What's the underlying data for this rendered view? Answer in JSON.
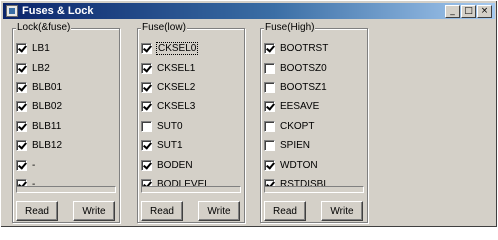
{
  "window": {
    "title": "Fuses & Lock",
    "minimize_label": "_",
    "maximize_label": "□",
    "close_label": "×"
  },
  "groups": [
    {
      "title": "Lock(&fuse)",
      "items": [
        {
          "label": "LB1",
          "checked": true
        },
        {
          "label": "LB2",
          "checked": true
        },
        {
          "label": "BLB01",
          "checked": true
        },
        {
          "label": "BLB02",
          "checked": true
        },
        {
          "label": "BLB11",
          "checked": true
        },
        {
          "label": "BLB12",
          "checked": true
        },
        {
          "label": "-",
          "checked": true
        },
        {
          "label": "-",
          "checked": true
        }
      ],
      "read_label": "Read",
      "write_label": "Write"
    },
    {
      "title": "Fuse(low)",
      "items": [
        {
          "label": "CKSEL0",
          "checked": true,
          "focused": true
        },
        {
          "label": "CKSEL1",
          "checked": true
        },
        {
          "label": "CKSEL2",
          "checked": true
        },
        {
          "label": "CKSEL3",
          "checked": true
        },
        {
          "label": "SUT0",
          "checked": false
        },
        {
          "label": "SUT1",
          "checked": true
        },
        {
          "label": "BODEN",
          "checked": true
        },
        {
          "label": "BODLEVEL",
          "checked": true
        }
      ],
      "read_label": "Read",
      "write_label": "Write"
    },
    {
      "title": "Fuse(High)",
      "items": [
        {
          "label": "BOOTRST",
          "checked": true
        },
        {
          "label": "BOOTSZ0",
          "checked": false
        },
        {
          "label": "BOOTSZ1",
          "checked": false
        },
        {
          "label": "EESAVE",
          "checked": true
        },
        {
          "label": "CKOPT",
          "checked": false
        },
        {
          "label": "SPIEN",
          "checked": false
        },
        {
          "label": "WDTON",
          "checked": true
        },
        {
          "label": "RSTDISBL",
          "checked": true
        }
      ],
      "read_label": "Read",
      "write_label": "Write"
    }
  ]
}
